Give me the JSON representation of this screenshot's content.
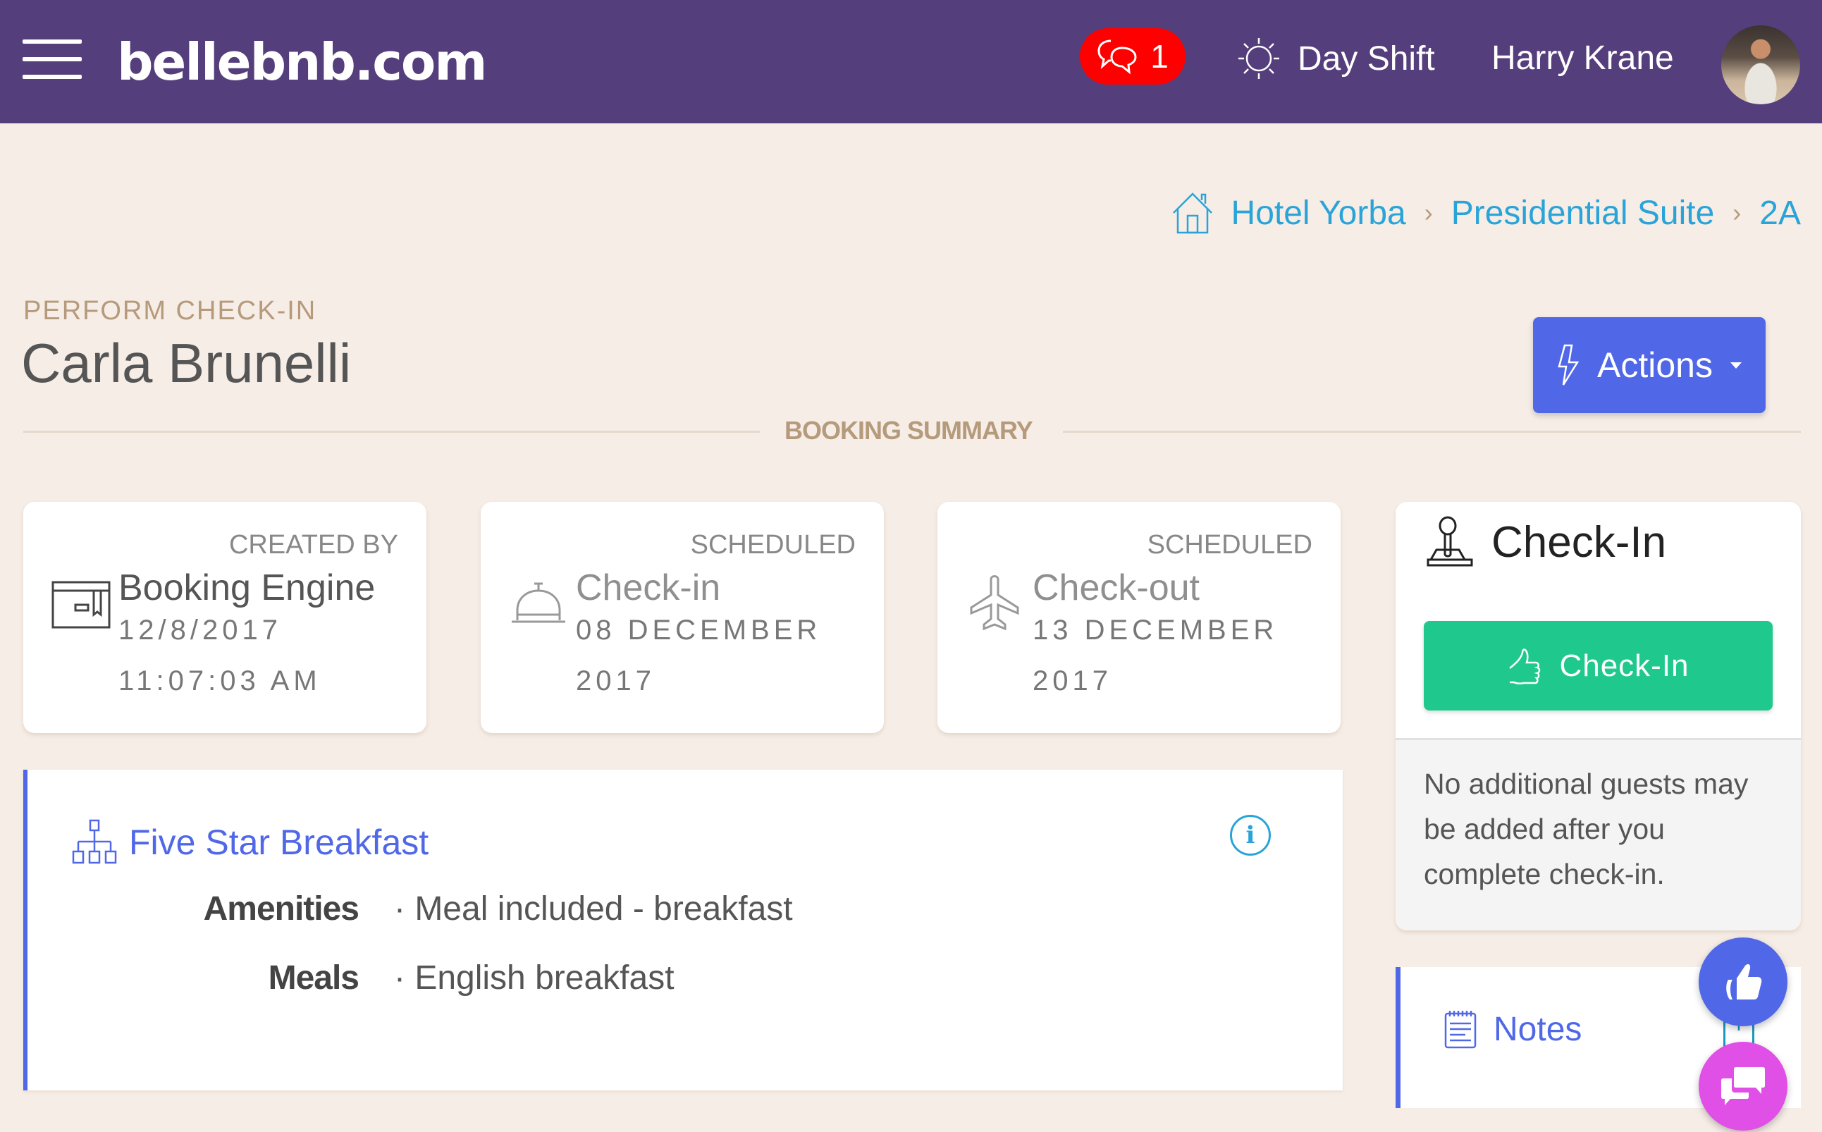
{
  "header": {
    "logo": "bellebnb.com",
    "messages_count": "1",
    "shift_label": "Day Shift",
    "user_name": "Harry Krane",
    "colors": {
      "bar": "#553e7c",
      "badge": "#ff0000"
    }
  },
  "breadcrumb": {
    "items": [
      "Hotel Yorba",
      "Presidential Suite",
      "2A"
    ],
    "separator": "›"
  },
  "page": {
    "subtitle": "PERFORM CHECK-IN",
    "title": "Carla Brunelli",
    "actions_label": "Actions",
    "section_label": "BOOKING SUMMARY"
  },
  "cards": [
    {
      "label": "CREATED BY",
      "main": "Booking Engine",
      "line1": "12/8/2017",
      "line2": "11:07:03 AM",
      "icon": "booking-box-icon"
    },
    {
      "label": "SCHEDULED",
      "main": "Check-in",
      "line1": "08 DECEMBER",
      "line2": "2017",
      "icon": "service-bell-icon"
    },
    {
      "label": "SCHEDULED",
      "main": "Check-out",
      "line1": "13 DECEMBER",
      "line2": "2017",
      "icon": "airplane-icon"
    }
  ],
  "checkin_panel": {
    "title": "Check-In",
    "button_label": "Check-In",
    "note": "No additional guests may be added after you complete check-in."
  },
  "package": {
    "title": "Five Star Breakfast",
    "rows": [
      {
        "key": "Amenities",
        "value": "· Meal included - breakfast"
      },
      {
        "key": "Meals",
        "value": "· English breakfast"
      }
    ]
  },
  "notes": {
    "title": "Notes",
    "add_label": "+"
  },
  "colors": {
    "accent": "#5068e8",
    "link": "#2aa4d8",
    "success": "#1fc98e",
    "chat_fab": "#e050e6",
    "background": "#f6ede6",
    "muted_tan": "#b59a7c"
  }
}
